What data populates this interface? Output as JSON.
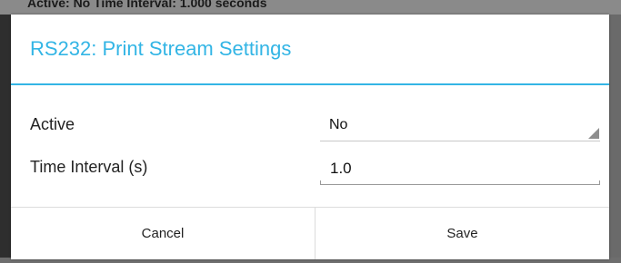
{
  "background": {
    "text": "Active: No  Time Interval: 1.000 seconds"
  },
  "dialog": {
    "title": "RS232: Print Stream Settings",
    "accent_color": "#33b5e5",
    "fields": {
      "active": {
        "label": "Active",
        "value": "No"
      },
      "time_interval": {
        "label": "Time Interval (s)",
        "value": "1.0"
      }
    },
    "buttons": {
      "cancel": "Cancel",
      "save": "Save"
    }
  }
}
